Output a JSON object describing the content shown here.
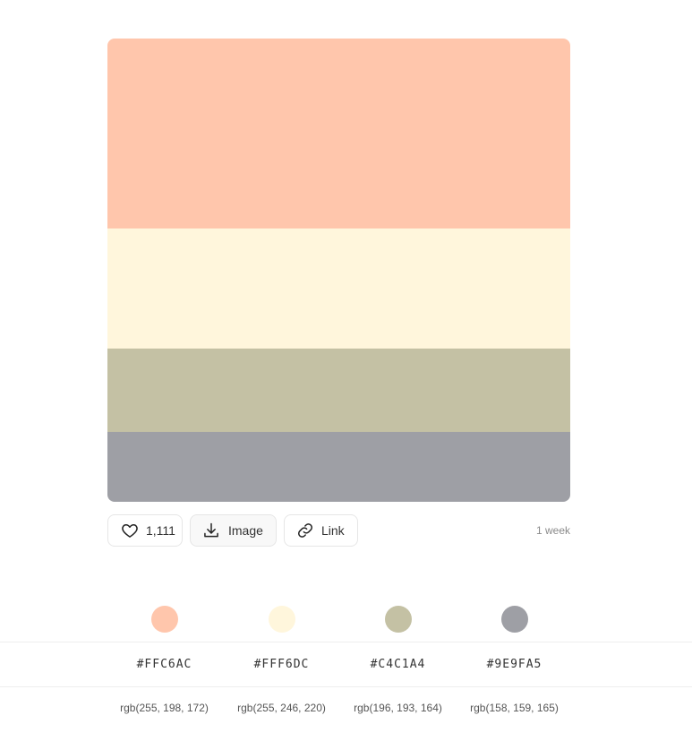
{
  "palette": {
    "colors": [
      {
        "hex": "#FFC6AC",
        "rgb": "rgb(255, 198, 172)",
        "value": "#FFC6AC"
      },
      {
        "hex": "#FFF6DC",
        "rgb": "rgb(255, 246, 220)",
        "value": "#FFF6DC"
      },
      {
        "hex": "#C4C1A4",
        "rgb": "rgb(196, 193, 164)",
        "value": "#C4C1A4"
      },
      {
        "hex": "#9E9FA5",
        "rgb": "rgb(158, 159, 165)",
        "value": "#9E9FA5"
      }
    ]
  },
  "actions": {
    "likes": "1,111",
    "like_icon": "heart-icon",
    "image_label": "Image",
    "image_icon": "download-icon",
    "link_label": "Link",
    "link_icon": "link-icon",
    "posted": "1 week"
  }
}
